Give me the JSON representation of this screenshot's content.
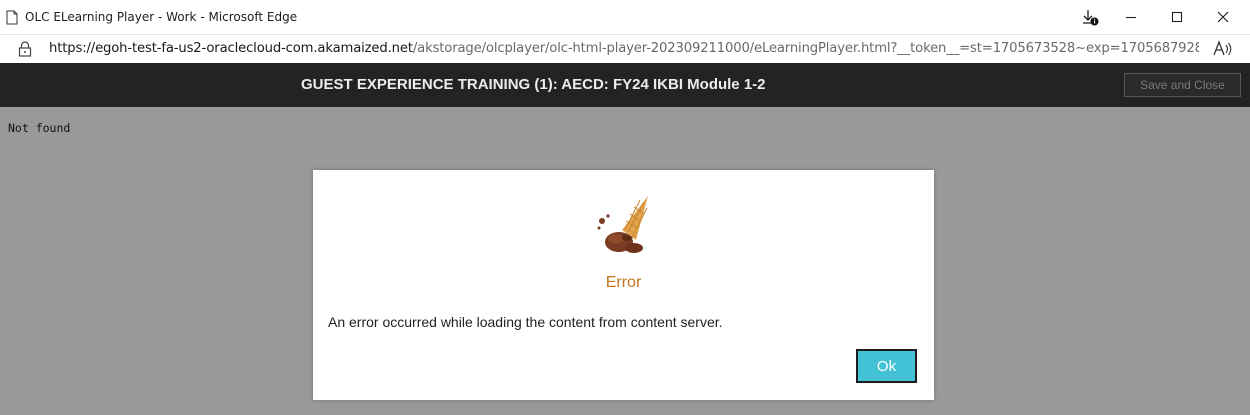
{
  "window": {
    "title": "OLC ELearning Player - Work - Microsoft Edge",
    "icons": [
      "page-icon",
      "downloads-icon",
      "minimize-icon",
      "maximize-icon",
      "close-icon"
    ]
  },
  "address_bar": {
    "url_host": "https://egoh-test-fa-us2-oraclecloud-com.akamaized.net",
    "url_rest": "/akstorage/olcplayer/olc-html-player-202309211000/eLearningPlayer.html?__token__=st=1705673528~exp=1705687928~acl=/...",
    "icons": [
      "lock-icon",
      "read-aloud-icon"
    ]
  },
  "player": {
    "course_title": "GUEST EXPERIENCE TRAINING (1): AECD: FY24 IKBI Module 1-2",
    "save_close_label": "Save and Close",
    "page_text": "Not found"
  },
  "dialog": {
    "icon": "dropped-ice-cream-icon",
    "title": "Error",
    "message": "An error occurred while loading the content from content server.",
    "ok_label": "Ok"
  },
  "colors": {
    "header_bg": "#232323",
    "overlay": "#999999",
    "error_title": "#c5741c",
    "ok_button": "#42c2d4"
  }
}
